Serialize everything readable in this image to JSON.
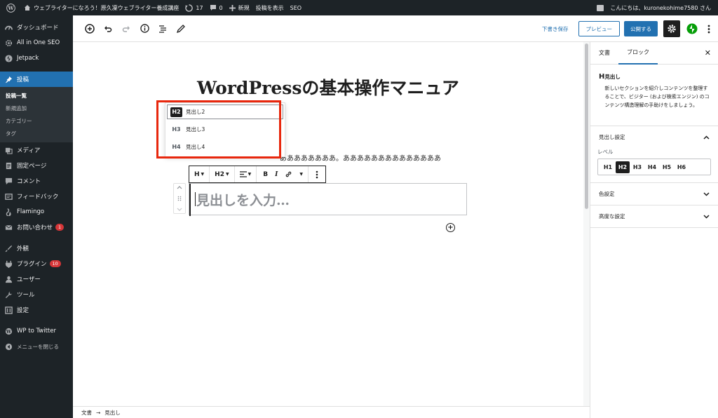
{
  "adminbar": {
    "site_name": "ウェブライターになろう！原久凜ウェブライター養成講座",
    "updates": "17",
    "comments": "0",
    "new": "新規",
    "view_post": "投稿を表示",
    "seo": "SEO",
    "greeting": "こんにちは、kuronekohime7580 さん"
  },
  "sidebar": {
    "items": [
      {
        "label": "ダッシュボード",
        "icon": "dashboard-icon"
      },
      {
        "label": "All in One SEO",
        "icon": "seo-icon"
      },
      {
        "label": "Jetpack",
        "icon": "jetpack-icon"
      },
      {
        "label": "投稿",
        "icon": "pin-icon"
      },
      {
        "label": "メディア",
        "icon": "media-icon"
      },
      {
        "label": "固定ページ",
        "icon": "page-icon"
      },
      {
        "label": "コメント",
        "icon": "comment-icon"
      },
      {
        "label": "フィードバック",
        "icon": "feedback-icon"
      },
      {
        "label": "Flamingo",
        "icon": "flamingo-icon"
      },
      {
        "label": "お問い合わせ",
        "icon": "mail-icon",
        "badge": "1"
      },
      {
        "label": "外観",
        "icon": "appearance-icon"
      },
      {
        "label": "プラグイン",
        "icon": "plugin-icon",
        "badge": "10"
      },
      {
        "label": "ユーザー",
        "icon": "users-icon"
      },
      {
        "label": "ツール",
        "icon": "tools-icon"
      },
      {
        "label": "設定",
        "icon": "settings-icon"
      },
      {
        "label": "WP to Twitter",
        "icon": "twitter-icon"
      },
      {
        "label": "メニューを閉じる",
        "icon": "collapse-icon"
      }
    ],
    "submenu": [
      "投稿一覧",
      "新規追加",
      "カテゴリー",
      "タグ"
    ]
  },
  "header": {
    "save_draft": "下書き保存",
    "preview": "プレビュー",
    "publish": "公開する"
  },
  "post": {
    "title": "WordPressの基本操作マニュア",
    "paragraph_visible": "ああああああああ。ああああああああああああああ",
    "heading_placeholder": "見出しを入力…"
  },
  "toolbar": {
    "block_type": "H",
    "level": "H2"
  },
  "level_dropdown": [
    {
      "tag": "H2",
      "label": "見出し2",
      "selected": true
    },
    {
      "tag": "H3",
      "label": "見出し3",
      "selected": false
    },
    {
      "tag": "H4",
      "label": "見出し4",
      "selected": false
    }
  ],
  "inspector": {
    "tab_document": "文書",
    "tab_block": "ブロック",
    "block_icon": "H",
    "block_name": "見出し",
    "block_desc": "新しいセクションを紹介しコンテンツを整理することで、ビジター (および検索エンジン) のコンテンツ構造理解の手助けをしましょう。",
    "heading_settings": "見出し設定",
    "level_label": "レベル",
    "levels": [
      "H1",
      "H2",
      "H3",
      "H4",
      "H5",
      "H6"
    ],
    "active_level": "H2",
    "color_settings": "色設定",
    "advanced": "高度な設定"
  },
  "footer": {
    "crumb_root": "文書",
    "arrow": "→",
    "crumb_current": "見出し"
  },
  "colors": {
    "admin_bg": "#1d2327",
    "accent": "#2271b1",
    "highlight": "#e8270d",
    "badge": "#d63638"
  }
}
